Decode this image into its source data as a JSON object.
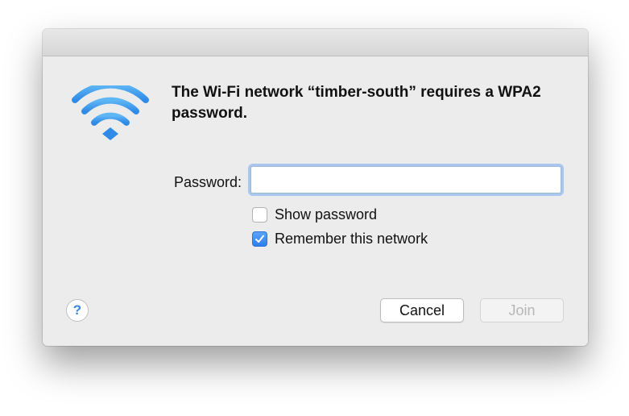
{
  "dialog": {
    "message": "The Wi-Fi network “timber-south” requires a WPA2 password."
  },
  "form": {
    "password_label": "Password:",
    "password_value": "",
    "show_password": {
      "label": "Show password",
      "checked": false
    },
    "remember_network": {
      "label": "Remember this network",
      "checked": true
    }
  },
  "buttons": {
    "help_label": "?",
    "cancel_label": "Cancel",
    "join_label": "Join",
    "join_enabled": false
  },
  "icons": {
    "wifi": "wifi-icon",
    "checkmark": "checkmark-icon",
    "help": "question-mark-icon"
  },
  "colors": {
    "accent": "#2d7ff0",
    "wifi": "#3f9ff0",
    "focus_ring": "#a8c6ee"
  }
}
